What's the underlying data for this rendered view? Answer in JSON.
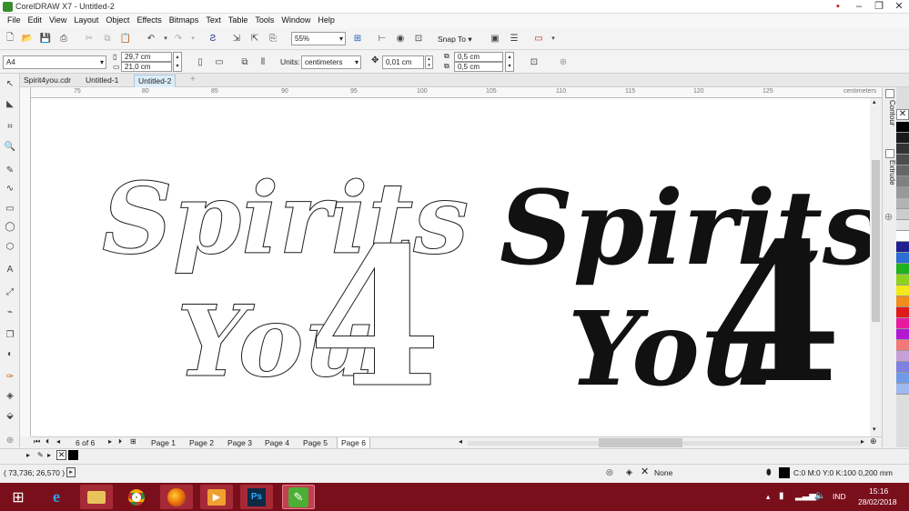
{
  "window": {
    "title": "CorelDRAW X7 - Untitled-2"
  },
  "menu": [
    "File",
    "Edit",
    "View",
    "Layout",
    "Object",
    "Effects",
    "Bitmaps",
    "Text",
    "Table",
    "Tools",
    "Window",
    "Help"
  ],
  "toolbar": {
    "zoom": "55%",
    "snap_label": "Snap To"
  },
  "property_bar": {
    "page_size": "A4",
    "width": "29,7 cm",
    "height": "21,0 cm",
    "units_label": "Units:",
    "units": "centimeters",
    "nudge": "0,01 cm",
    "dup_x": "0,5 cm",
    "dup_y": "0,5 cm"
  },
  "doc_tabs": [
    "Spirit4you.cdr",
    "Untitled-1",
    "Untitled-2"
  ],
  "ruler": {
    "ticks": [
      "75",
      "80",
      "85",
      "90",
      "95",
      "100",
      "105",
      "110",
      "115",
      "120",
      "125"
    ],
    "units": "centimeters"
  },
  "artwork": {
    "line1": "Spirits",
    "line2": "You",
    "digit": "4"
  },
  "dockers": [
    "Contour",
    "Extrude"
  ],
  "pages": {
    "counter": "6 of 6",
    "tabs": [
      "Page 1",
      "Page 2",
      "Page 3",
      "Page 4",
      "Page 5",
      "Page 6"
    ]
  },
  "status": {
    "coords": "( 73,736; 26,570 )",
    "fill": "None",
    "outline": "C:0 M:0 Y:0 K:100  0,200 mm"
  },
  "palette_colors": [
    "#000000",
    "#1a1a1a",
    "#333333",
    "#4d4d4d",
    "#666666",
    "#808080",
    "#999999",
    "#b3b3b3",
    "#cccccc",
    "#e6e6e6",
    "#ffffff",
    "#1f1f8f",
    "#2a6fd1",
    "#1fb21f",
    "#8ed21f",
    "#f2e81a",
    "#f28c1a",
    "#e01a1a",
    "#e81aa0",
    "#b21ad2",
    "#f27878",
    "#c8a0d8",
    "#8080e0",
    "#6f9ae8",
    "#a0b8f0"
  ],
  "taskbar": {
    "lang": "IND",
    "time": "15:16",
    "date": "28/02/2018"
  }
}
